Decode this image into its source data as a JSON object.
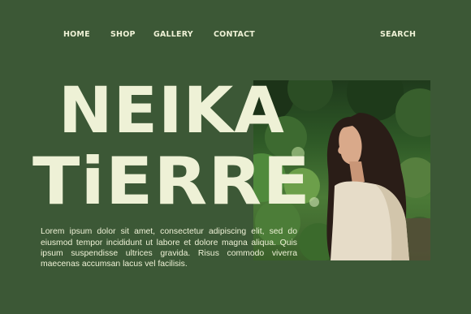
{
  "nav": {
    "home": "HOME",
    "shop": "SHOP",
    "gallery": "GALLERY",
    "contact": "CONTACT",
    "search": "SEARCH"
  },
  "hero": {
    "title_line1": "NEIKA",
    "title_line2": "TiERRE",
    "paragraph": "Lorem ipsum dolor sit amet, consectetur adipiscing elit, sed do eiusmod tempor incididunt ut labore et dolore magna aliqua. Quis ipsum suspendisse ultrices gravida. Risus commodo viverra maecenas accumsan lacus vel facilisis."
  },
  "colors": {
    "background": "#3c5836",
    "text": "#eef1d6"
  }
}
